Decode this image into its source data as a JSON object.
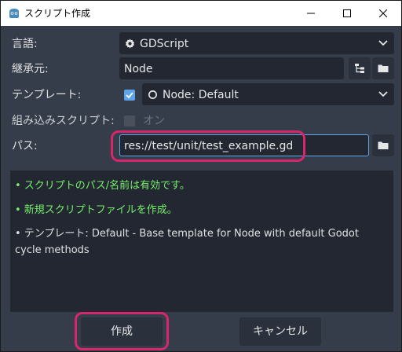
{
  "window": {
    "title": "スクリプト作成",
    "controls": [
      "minimize",
      "maximize",
      "close"
    ]
  },
  "form": {
    "language": {
      "label": "言語:",
      "value": "GDScript",
      "icon": "gear-icon"
    },
    "inherits": {
      "label": "継承元:",
      "value": "Node"
    },
    "template": {
      "label": "テンプレート:",
      "checked": true,
      "value": "Node: Default",
      "icon": "circle-icon"
    },
    "builtin": {
      "label": "組み込みスクリプト:",
      "checked": false,
      "option_label": "オン"
    },
    "path": {
      "label": "パス:",
      "value": "res://test/unit/test_example.gd"
    }
  },
  "status": {
    "messages": [
      {
        "text": "•  スクリプトのパス/名前は有効です。",
        "type": "ok"
      },
      {
        "text": "•  新規スクリプトファイルを作成。",
        "type": "ok"
      },
      {
        "text": "•  テンプレート: Default - Base template for Node with default Godot cycle methods",
        "type": "info"
      }
    ]
  },
  "buttons": {
    "create": "作成",
    "cancel": "キャンセル"
  },
  "colors": {
    "background": "#363d4a",
    "field": "#222732",
    "accent": "#5fa3e8",
    "ok_text": "#76f06a",
    "highlight": "#d8266c"
  }
}
